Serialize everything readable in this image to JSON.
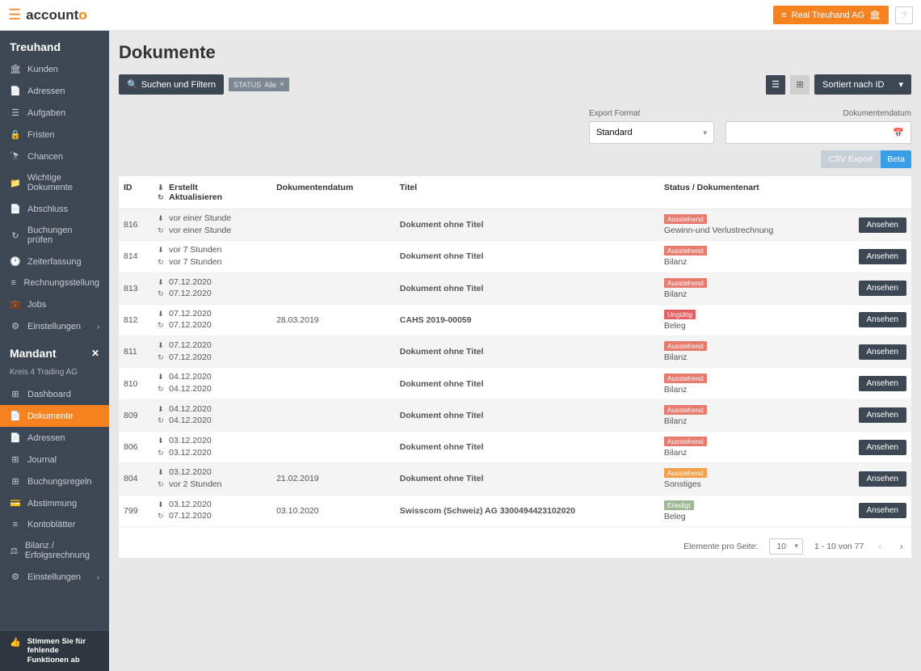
{
  "topbar": {
    "logo_prefix": "account",
    "logo_suffix": "o",
    "org_button": "Real Treuhand AG"
  },
  "sidebar": {
    "section1_title": "Treuhand",
    "items1": [
      {
        "icon": "🏛",
        "label": "Kunden"
      },
      {
        "icon": "📄",
        "label": "Adressen"
      },
      {
        "icon": "☰",
        "label": "Aufgaben"
      },
      {
        "icon": "🔒",
        "label": "Fristen"
      },
      {
        "icon": "🔭",
        "label": "Chancen"
      },
      {
        "icon": "📁",
        "label": "Wichtige Dokumente"
      },
      {
        "icon": "📄",
        "label": "Abschluss"
      },
      {
        "icon": "↻",
        "label": "Buchungen prüfen"
      },
      {
        "icon": "🕐",
        "label": "Zeiterfassung"
      },
      {
        "icon": "≡",
        "label": "Rechnungsstellung"
      },
      {
        "icon": "💼",
        "label": "Jobs"
      },
      {
        "icon": "⚙",
        "label": "Einstellungen",
        "chev": true
      }
    ],
    "section2_title": "Mandant",
    "mandant_name": "Kreis 4 Trading AG",
    "items2": [
      {
        "icon": "⊞",
        "label": "Dashboard"
      },
      {
        "icon": "📄",
        "label": "Dokumente",
        "active": true
      },
      {
        "icon": "📄",
        "label": "Adressen"
      },
      {
        "icon": "⊞",
        "label": "Journal"
      },
      {
        "icon": "⊞",
        "label": "Buchungsregeln"
      },
      {
        "icon": "💳",
        "label": "Abstimmung"
      },
      {
        "icon": "≡",
        "label": "Kontoblätter"
      },
      {
        "icon": "⚖",
        "label": "Bilanz / Erfolgsrechnung"
      },
      {
        "icon": "⚙",
        "label": "Einstellungen",
        "chev": true
      }
    ],
    "footer_text": "Stimmen Sie für fehlende Funktionen ab"
  },
  "page": {
    "title": "Dokumente",
    "search_btn": "Suchen und Filtern",
    "status_chip_label": "STATUS",
    "status_chip_value": "Alle",
    "sort_btn": "Sortiert nach ID",
    "export_format_label": "Export Format",
    "export_format_value": "Standard",
    "doc_date_label": "Dokumentendatum",
    "csv_export": "CSV Export",
    "beta": "Beta"
  },
  "table": {
    "col_id": "ID",
    "col_created": "Erstellt",
    "col_updated": "Aktualisieren",
    "col_docdate": "Dokumentendatum",
    "col_title": "Titel",
    "col_status": "Status / Dokumentenart",
    "view_label": "Ansehen",
    "rows": [
      {
        "id": "816",
        "created": "vor einer Stunde",
        "updated": "vor einer Stunde",
        "docdate": "",
        "title": "Dokument ohne Titel",
        "badge": "Ausstehend",
        "badge_cls": "aus",
        "type": "Gewinn-und Verlustrechnung"
      },
      {
        "id": "814",
        "created": "vor 7 Stunden",
        "updated": "vor 7 Stunden",
        "docdate": "",
        "title": "Dokument ohne Titel",
        "badge": "Ausstehend",
        "badge_cls": "aus",
        "type": "Bilanz"
      },
      {
        "id": "813",
        "created": "07.12.2020",
        "updated": "07.12.2020",
        "docdate": "",
        "title": "Dokument ohne Titel",
        "badge": "Ausstehend",
        "badge_cls": "aus",
        "type": "Bilanz"
      },
      {
        "id": "812",
        "created": "07.12.2020",
        "updated": "07.12.2020",
        "docdate": "28.03.2019",
        "title": "CAHS 2019-00059",
        "badge": "Ungültig",
        "badge_cls": "ung",
        "type": "Beleg"
      },
      {
        "id": "811",
        "created": "07.12.2020",
        "updated": "07.12.2020",
        "docdate": "",
        "title": "Dokument ohne Titel",
        "badge": "Ausstehend",
        "badge_cls": "aus",
        "type": "Bilanz"
      },
      {
        "id": "810",
        "created": "04.12.2020",
        "updated": "04.12.2020",
        "docdate": "",
        "title": "Dokument ohne Titel",
        "badge": "Ausstehend",
        "badge_cls": "aus",
        "type": "Bilanz"
      },
      {
        "id": "809",
        "created": "04.12.2020",
        "updated": "04.12.2020",
        "docdate": "",
        "title": "Dokument ohne Titel",
        "badge": "Ausstehend",
        "badge_cls": "aus",
        "type": "Bilanz"
      },
      {
        "id": "806",
        "created": "03.12.2020",
        "updated": "03.12.2020",
        "docdate": "",
        "title": "Dokument ohne Titel",
        "badge": "Ausstehend",
        "badge_cls": "aus",
        "type": "Bilanz"
      },
      {
        "id": "804",
        "created": "03.12.2020",
        "updated": "vor 2 Stunden",
        "docdate": "21.02.2019",
        "title": "Dokument ohne Titel",
        "badge": "Ausstehend",
        "badge_cls": "aus2",
        "type": "Sonstiges"
      },
      {
        "id": "799",
        "created": "03.12.2020",
        "updated": "07.12.2020",
        "docdate": "03.10.2020",
        "title": "Swisscom (Schweiz) AG 3300494423102020",
        "badge": "Erledigt",
        "badge_cls": "erl",
        "type": "Beleg"
      }
    ]
  },
  "pager": {
    "per_page_label": "Elemente pro Seite:",
    "per_page_value": "10",
    "range": "1 - 10 von 77"
  }
}
